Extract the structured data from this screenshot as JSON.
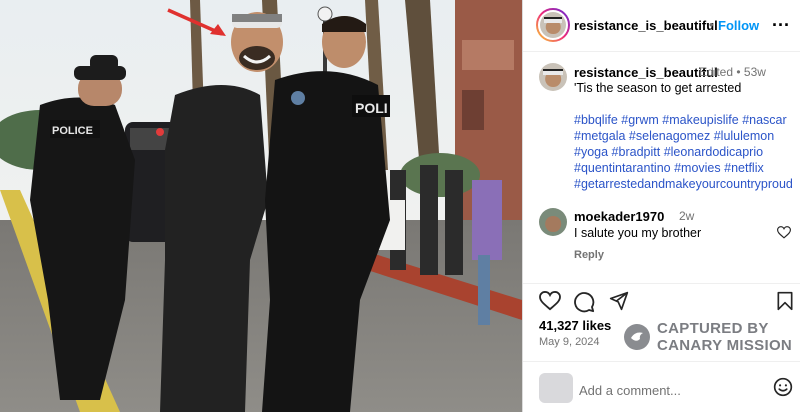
{
  "post": {
    "username": "resistance_is_beautiful",
    "follow_label": "Follow",
    "header_dot": "•",
    "more_label": "...",
    "caption": {
      "username": "resistance_is_beautiful",
      "edited": "Edited • 53w",
      "text": "'Tis the season to get arrested",
      "hashtags": [
        "#bbqlife",
        "#grwm",
        "#makeupislife",
        "#nascar",
        "#metgala",
        "#selenagomez",
        "#lululemon",
        "#yoga",
        "#bradpitt",
        "#leonardodicaprio",
        "#quentintarantino",
        "#movies",
        "#netflix",
        "#getarrestedandmakeyourcountryproud"
      ]
    },
    "comment": {
      "username": "moekader1970",
      "time": "2w",
      "text": "I salute you my brother",
      "reply_label": "Reply"
    },
    "likes": "41,327 likes",
    "date": "May 9, 2024",
    "watermark": {
      "line1": "CAPTURED BY",
      "line2": "CANARY MISSION"
    },
    "add_comment_placeholder": "Add a comment...",
    "icons": [
      "heart-icon",
      "comment-icon",
      "share-icon",
      "bookmark-icon",
      "more-icon",
      "emoji-icon"
    ],
    "colors": {
      "link": "#0095f6",
      "hashtag": "#2b54c8",
      "muted": "#737373"
    }
  },
  "photo": {
    "vest_label_left": "POLICE",
    "vest_label_right": "POLI"
  }
}
